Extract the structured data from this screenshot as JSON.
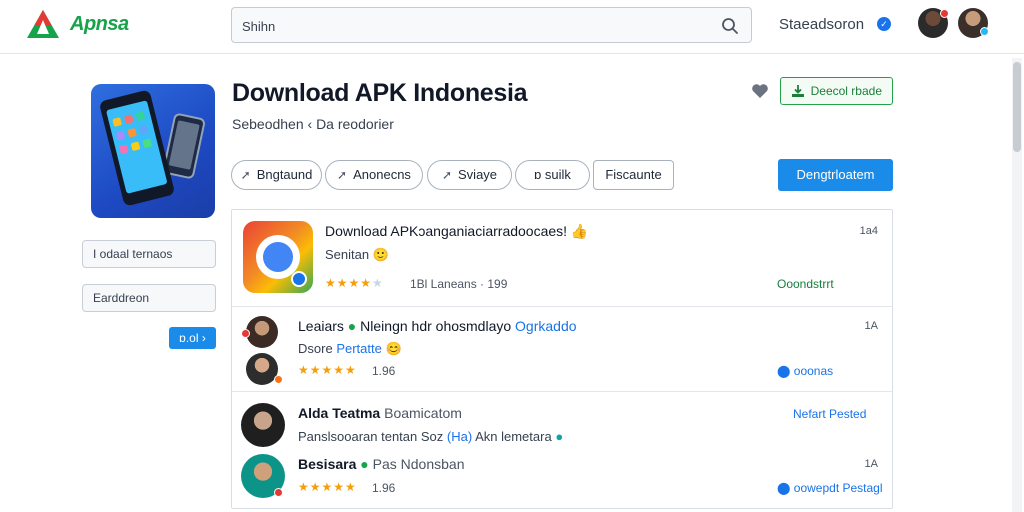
{
  "header": {
    "brand": "Apnsa",
    "search_value": "Shihn",
    "status_label": "Staeadsoron"
  },
  "sidebar": {
    "field1": "I odaal ternaos",
    "field2": "Earddreon",
    "button": "ɒ.ol ›"
  },
  "main": {
    "title": "Download APK Indonesia",
    "subtitle": "Sebeodhen ‹ Da reodorier",
    "action_button": "Deecol rbade",
    "primary_button": "Dengtrloatem",
    "chips": [
      "Bngtaund",
      "Anonecns",
      "Sviaye",
      "ɒ suilk",
      "Fiscaunte"
    ]
  },
  "list": {
    "row1": {
      "title": "Download APKɔanganiaciarradoocaes! 👍",
      "subtitle": "Senitan 🙂",
      "stars": 4,
      "rating": "1Bl Laneans · 199",
      "time": "1a4",
      "status": "Ooondstrrt"
    },
    "row2": {
      "title_name": "Leaiars",
      "title_rest": "Nleingn hdr ohosmdlayo",
      "title_link": "Ogrkaddo",
      "text": "Dsore",
      "link": "Pertatte",
      "stars": 5,
      "rating": "1.96",
      "time": "1A",
      "status": "ooonas"
    },
    "row3": {
      "name1": "Alda Teatma",
      "meta1": "Boamicatom",
      "link1": "Nefart Pested",
      "text": "Panslsooaran tentan Soz",
      "text_link": "(Ha)",
      "text_rest": "Akn lemetara",
      "name2": "Besisara",
      "meta2": "Pas Ndonsban",
      "stars": 5,
      "rating": "1.96",
      "time": "1A",
      "status": "oowepdt Pestagl"
    }
  },
  "colors": {
    "accent": "#1a8be8",
    "brand": "#16a34a",
    "star": "#f59e0b"
  }
}
